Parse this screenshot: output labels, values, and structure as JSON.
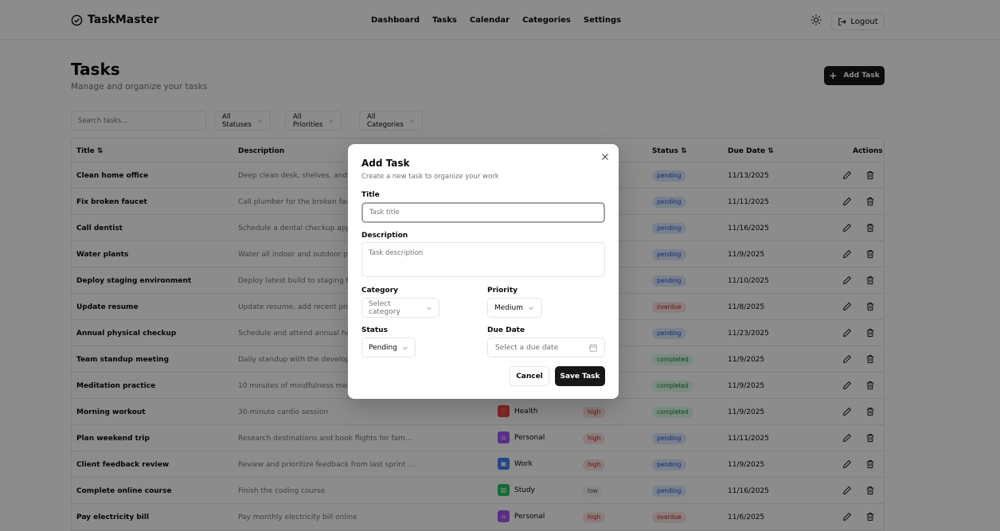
{
  "app": {
    "brand": "TaskMaster",
    "nav": [
      "Dashboard",
      "Tasks",
      "Calendar",
      "Categories",
      "Settings"
    ],
    "logout_label": "Logout"
  },
  "page": {
    "title": "Tasks",
    "subtitle": "Manage and organize your tasks",
    "add_button": "Add Task"
  },
  "filters": {
    "search_placeholder": "Search tasks...",
    "status": "All Statuses",
    "priority": "All Priorities",
    "category": "All Categories"
  },
  "table": {
    "headers": {
      "title": "Title",
      "description": "Description",
      "status": "Status",
      "due_date": "Due Date",
      "actions": "Actions"
    },
    "rows": [
      {
        "title": "Clean home office",
        "description": "Deep clean desk, shelves, and organize files",
        "category": "",
        "priority": "",
        "status": "pending",
        "due": "11/13/2025"
      },
      {
        "title": "Fix broken faucet",
        "description": "Call plumber for the broken faucet",
        "category": "",
        "priority": "",
        "status": "pending",
        "due": "11/11/2025"
      },
      {
        "title": "Call dentist",
        "description": "Schedule a dental checkup appointment",
        "category": "",
        "priority": "",
        "status": "pending",
        "due": "11/16/2025"
      },
      {
        "title": "Water plants",
        "description": "Water all indoor and outdoor plants",
        "category": "",
        "priority": "",
        "status": "pending",
        "due": "11/9/2025"
      },
      {
        "title": "Deploy staging environment",
        "description": "Deploy latest build to staging for QA",
        "category": "",
        "priority": "",
        "status": "pending",
        "due": "11/10/2025"
      },
      {
        "title": "Update resume",
        "description": "Update resume, add recent projects",
        "category": "",
        "priority": "",
        "status": "overdue",
        "due": "11/8/2025"
      },
      {
        "title": "Annual physical checkup",
        "description": "Schedule and attend annual health exam",
        "category": "",
        "priority": "",
        "status": "pending",
        "due": "11/23/2025"
      },
      {
        "title": "Team standup meeting",
        "description": "Daily standup with the development team",
        "category": "",
        "priority": "",
        "status": "completed",
        "due": "11/9/2025"
      },
      {
        "title": "Meditation practice",
        "description": "10 minutes of mindfulness meditation",
        "category": "",
        "priority": "",
        "status": "completed",
        "due": "11/9/2025"
      },
      {
        "title": "Morning workout",
        "description": "30-minute cardio session",
        "category": "Health",
        "priority": "high",
        "status": "completed",
        "due": "11/9/2025"
      },
      {
        "title": "Plan weekend trip",
        "description": "Research destinations and book flights for fam...",
        "category": "Personal",
        "priority": "high",
        "status": "pending",
        "due": "11/11/2025"
      },
      {
        "title": "Client feedback review",
        "description": "Review and prioritize feedback from last sprint ...",
        "category": "Work",
        "priority": "high",
        "status": "pending",
        "due": "11/9/2025"
      },
      {
        "title": "Complete online course",
        "description": "Finish the coding course",
        "category": "Study",
        "priority": "low",
        "status": "pending",
        "due": "11/16/2025"
      },
      {
        "title": "Pay electricity bill",
        "description": "Pay monthly electricity bill online",
        "category": "Personal",
        "priority": "high",
        "status": "overdue",
        "due": "11/6/2025"
      }
    ]
  },
  "category_colors": {
    "Health": "#ef4444",
    "Personal": "#a855f7",
    "Work": "#3b82f6",
    "Study": "#22c55e"
  },
  "modal": {
    "title": "Add Task",
    "description": "Create a new task to organize your work",
    "title_label": "Title",
    "title_placeholder": "Task title",
    "description_label": "Description",
    "description_placeholder": "Task description",
    "category_label": "Category",
    "category_value": "Select category",
    "priority_label": "Priority",
    "priority_value": "Medium",
    "status_label": "Status",
    "status_value": "Pending",
    "due_label": "Due Date",
    "due_placeholder": "Select a due date",
    "cancel_label": "Cancel",
    "save_label": "Save Task"
  }
}
